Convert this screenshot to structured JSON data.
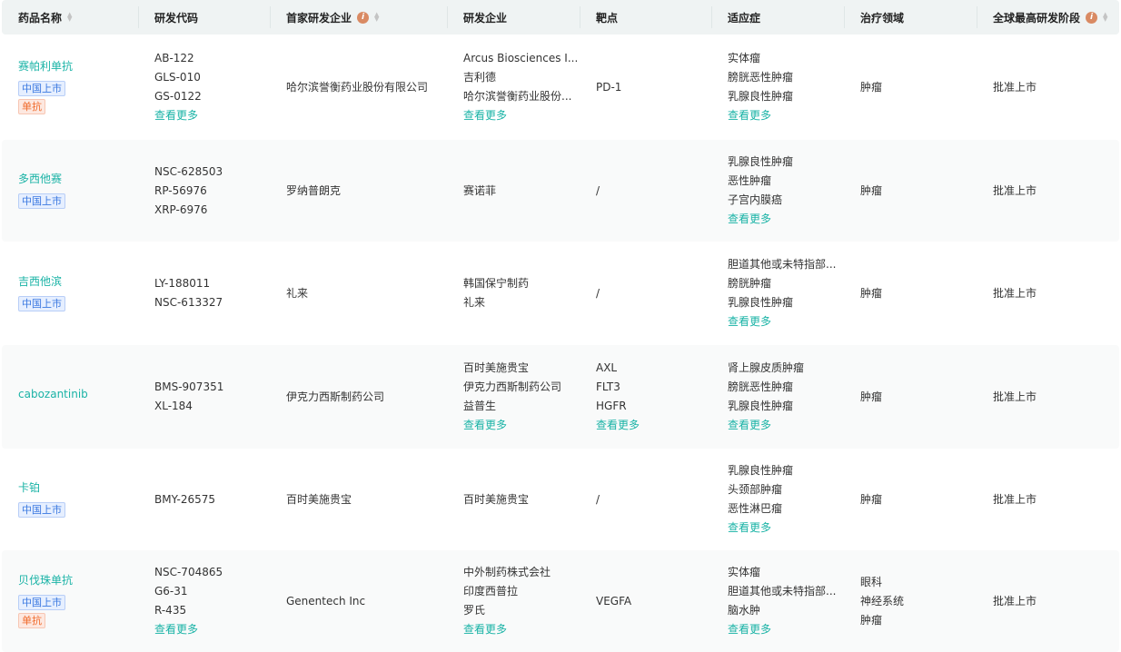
{
  "headers": [
    {
      "label": "药品名称",
      "sort": true,
      "info": false
    },
    {
      "label": "研发代码",
      "sort": false,
      "info": false
    },
    {
      "label": "首家研发企业",
      "sort": true,
      "info": true
    },
    {
      "label": "研发企业",
      "sort": false,
      "info": false
    },
    {
      "label": "靶点",
      "sort": false,
      "info": false
    },
    {
      "label": "适应症",
      "sort": false,
      "info": false
    },
    {
      "label": "治疗领域",
      "sort": false,
      "info": false
    },
    {
      "label": "全球最高研发阶段",
      "sort": true,
      "info": true
    }
  ],
  "more_label": "查看更多",
  "rows": [
    {
      "name": "赛帕利单抗",
      "tags": [
        "中国上市",
        "单抗"
      ],
      "codes": [
        "AB-122",
        "GLS-010",
        "GS-0122"
      ],
      "codes_more": true,
      "first_company": "哈尔滨誉衡药业股份有限公司",
      "companies": [
        "Arcus Biosciences I...",
        "吉利德",
        "哈尔滨誉衡药业股份..."
      ],
      "companies_more": true,
      "targets": [
        "PD-1"
      ],
      "targets_more": false,
      "indications": [
        "实体瘤",
        "膀胱恶性肿瘤",
        "乳腺良性肿瘤"
      ],
      "indications_more": true,
      "areas": [
        "肿瘤"
      ],
      "stage": "批准上市",
      "height": 116
    },
    {
      "name": "多西他赛",
      "tags": [
        "中国上市"
      ],
      "codes": [
        "NSC-628503",
        "RP-56976",
        "XRP-6976"
      ],
      "codes_more": false,
      "first_company": "罗纳普朗克",
      "companies": [
        "赛诺菲"
      ],
      "companies_more": false,
      "targets": [
        "/"
      ],
      "targets_more": false,
      "indications": [
        "乳腺良性肿瘤",
        "恶性肿瘤",
        "子宫内膜癌"
      ],
      "indications_more": true,
      "areas": [
        "肿瘤"
      ],
      "stage": "批准上市",
      "height": 112
    },
    {
      "name": "吉西他滨",
      "tags": [
        "中国上市"
      ],
      "codes": [
        "LY-188011",
        "NSC-613327"
      ],
      "codes_more": false,
      "first_company": "礼来",
      "companies": [
        "韩国保宁制药",
        "礼来"
      ],
      "companies_more": false,
      "targets": [
        "/"
      ],
      "targets_more": false,
      "indications": [
        "胆道其他或未特指部...",
        "膀胱肿瘤",
        "乳腺良性肿瘤"
      ],
      "indications_more": true,
      "areas": [
        "肿瘤"
      ],
      "stage": "批准上市",
      "height": 114
    },
    {
      "name": "cabozantinib",
      "tags": [],
      "codes": [
        "BMS-907351",
        "XL-184"
      ],
      "codes_more": false,
      "first_company": "伊克力西斯制药公司",
      "companies": [
        "百时美施贵宝",
        "伊克力西斯制药公司",
        "益普生"
      ],
      "companies_more": true,
      "targets": [
        "AXL",
        "FLT3",
        "HGFR"
      ],
      "targets_more": true,
      "indications": [
        "肾上腺皮质肿瘤",
        "膀胱恶性肿瘤",
        "乳腺良性肿瘤"
      ],
      "indications_more": true,
      "areas": [
        "肿瘤"
      ],
      "stage": "批准上市",
      "height": 114
    },
    {
      "name": "卡铂",
      "tags": [
        "中国上市"
      ],
      "codes": [
        "BMY-26575"
      ],
      "codes_more": false,
      "first_company": "百时美施贵宝",
      "companies": [
        "百时美施贵宝"
      ],
      "companies_more": false,
      "targets": [
        "/"
      ],
      "targets_more": false,
      "indications": [
        "乳腺良性肿瘤",
        "头颈部肿瘤",
        "恶性淋巴瘤"
      ],
      "indications_more": true,
      "areas": [
        "肿瘤"
      ],
      "stage": "批准上市",
      "height": 112
    },
    {
      "name": "贝伐珠单抗",
      "tags": [
        "中国上市",
        "单抗"
      ],
      "codes": [
        "NSC-704865",
        "G6-31",
        "R-435"
      ],
      "codes_more": true,
      "first_company": "Genentech Inc",
      "companies": [
        "中外制药株式会社",
        "印度西普拉",
        "罗氏"
      ],
      "companies_more": true,
      "targets": [
        "VEGFA"
      ],
      "targets_more": false,
      "indications": [
        "实体瘤",
        "胆道其他或未特指部...",
        "脑水肿"
      ],
      "indications_more": true,
      "areas": [
        "眼科",
        "神经系统",
        "肿瘤"
      ],
      "stage": "批准上市",
      "height": 112
    }
  ],
  "colors": {
    "accent": "#1ab3a6",
    "header_bg": "#eff3f3",
    "info": "#d98a63"
  }
}
